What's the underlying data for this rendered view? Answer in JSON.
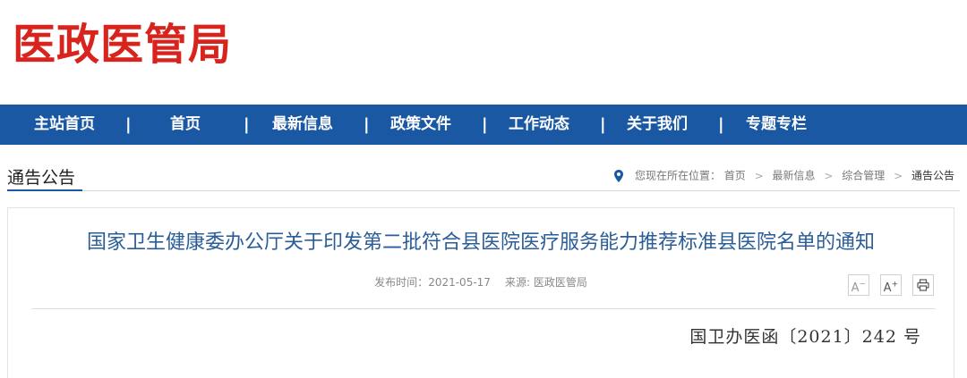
{
  "site": {
    "logo_text": "医政医管局",
    "brand_color": "#d9231d",
    "nav_color": "#1a58a3"
  },
  "nav": {
    "items": [
      {
        "label": "主站首页"
      },
      {
        "label": "首页"
      },
      {
        "label": "最新信息"
      },
      {
        "label": "政策文件"
      },
      {
        "label": "工作动态"
      },
      {
        "label": "关于我们"
      },
      {
        "label": "专题专栏"
      }
    ],
    "separator": "|"
  },
  "section": {
    "title": "通告公告"
  },
  "breadcrumb": {
    "icon": "location-pin-icon",
    "prefix": "您现在所在位置：",
    "items": [
      "首页",
      "最新信息",
      "综合管理",
      "通告公告"
    ],
    "separator": ">"
  },
  "article": {
    "title": "国家卫生健康委办公厅关于印发第二批符合县医院医疗服务能力推荐标准县医院名单的通知",
    "publish_label": "发布时间：",
    "publish_date": "2021-05-17",
    "source_label": "来源:",
    "source": "医政医管局",
    "doc_number": "国卫办医函〔2021〕242 号"
  },
  "tools": {
    "font_decrease": "A",
    "font_decrease_mark": "−",
    "font_increase": "A",
    "font_increase_mark": "+",
    "print_icon": "printer-icon"
  }
}
